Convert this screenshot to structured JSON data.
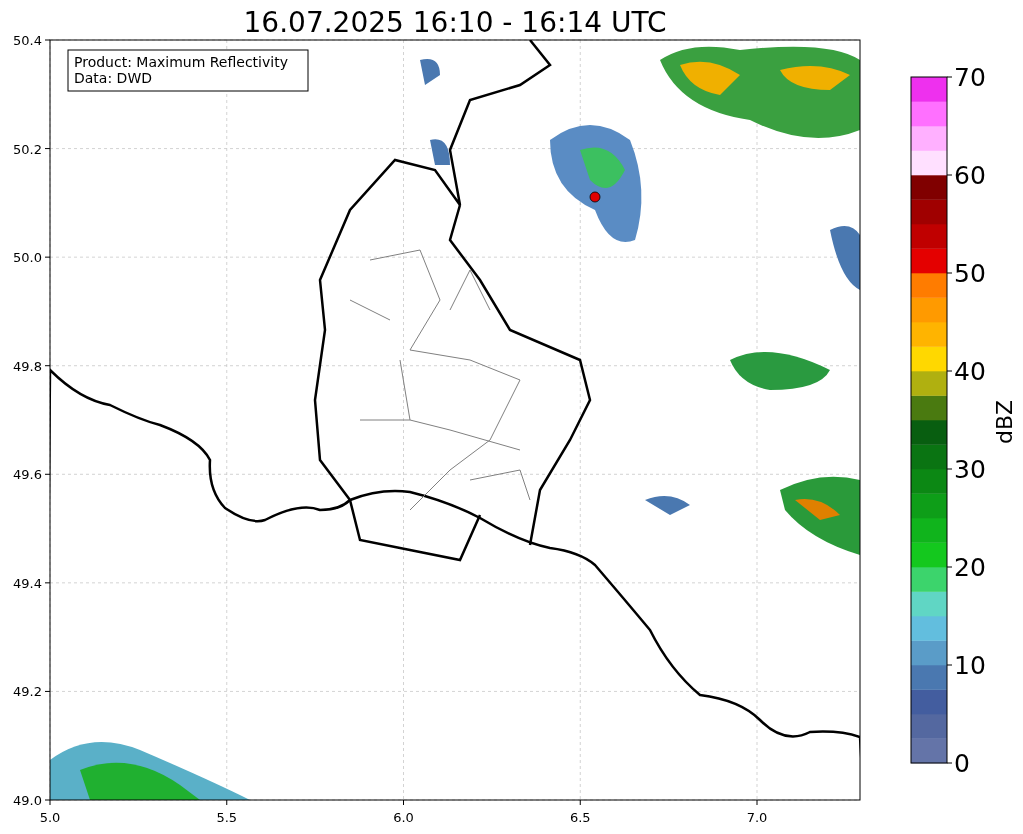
{
  "title": "16.07.2025 16:10 - 16:14 UTC",
  "legend": [
    "Product: Maximum Reflectivity",
    "Data: DWD"
  ],
  "x_ticks": [
    "5.0",
    "5.5",
    "6.0",
    "6.5",
    "7.0"
  ],
  "y_ticks": [
    "50.4",
    "50.2",
    "50.0",
    "49.8",
    "49.6",
    "49.4",
    "49.2",
    "49.0"
  ],
  "colorbar": {
    "label": "dBZ",
    "ticks": [
      "70",
      "60",
      "50",
      "40",
      "30",
      "20",
      "10",
      "0"
    ],
    "segments": [
      {
        "color": "#6474a8"
      },
      {
        "color": "#5468a0"
      },
      {
        "color": "#435d9f"
      },
      {
        "color": "#4a78b0"
      },
      {
        "color": "#5a9cc8"
      },
      {
        "color": "#62bede"
      },
      {
        "color": "#60d6c4"
      },
      {
        "color": "#3cd46c"
      },
      {
        "color": "#14c81e"
      },
      {
        "color": "#10b41c"
      },
      {
        "color": "#0e9e18"
      },
      {
        "color": "#0c8814"
      },
      {
        "color": "#0a7412"
      },
      {
        "color": "#085e10"
      },
      {
        "color": "#4a7a10"
      },
      {
        "color": "#b0b010"
      },
      {
        "color": "#ffd800"
      },
      {
        "color": "#ffb400"
      },
      {
        "color": "#ff9a00"
      },
      {
        "color": "#ff7c00"
      },
      {
        "color": "#e40000"
      },
      {
        "color": "#c00000"
      },
      {
        "color": "#a00000"
      },
      {
        "color": "#800000"
      },
      {
        "color": "#ffe0ff"
      },
      {
        "color": "#ffb0ff"
      },
      {
        "color": "#ff70ff"
      },
      {
        "color": "#ee30ee"
      }
    ]
  }
}
